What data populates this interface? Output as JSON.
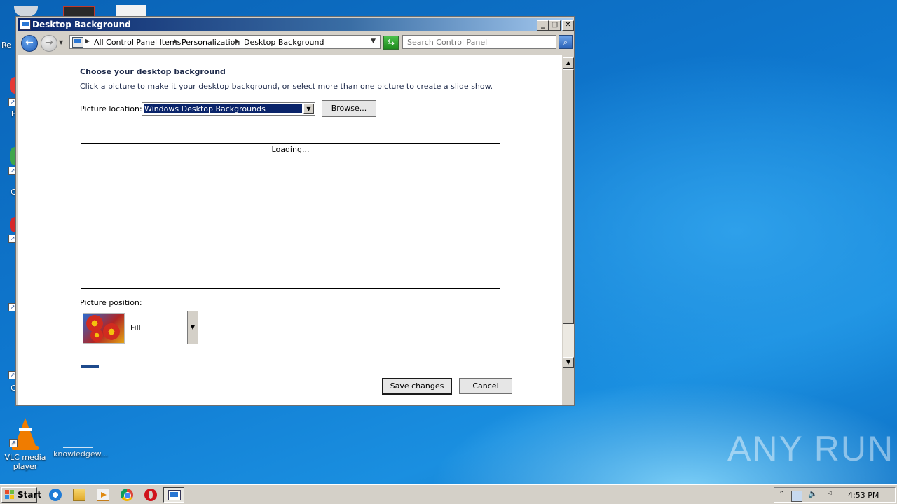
{
  "window": {
    "title": "Desktop Background",
    "minimize_label": "_",
    "maximize_label": "□",
    "close_label": "✕"
  },
  "navigation": {
    "breadcrumbs": [
      "All Control Panel Items",
      "Personalization",
      "Desktop Background"
    ],
    "search_placeholder": "Search Control Panel"
  },
  "page": {
    "heading": "Choose your desktop background",
    "description": "Click a picture to make it your desktop background, or select more than one picture to create a slide show.",
    "picture_location_label": "Picture location:",
    "picture_location_value": "Windows Desktop Backgrounds",
    "browse_button": "Browse...",
    "gallery_status": "Loading...",
    "picture_position_label": "Picture position:",
    "picture_position_value": "Fill",
    "save_button": "Save changes",
    "cancel_button": "Cancel"
  },
  "desktop": {
    "icons": [
      {
        "label": "VLC media player"
      },
      {
        "label": "knowledgew..."
      }
    ],
    "partial_labels": [
      "Re",
      "F",
      "C",
      "C"
    ]
  },
  "watermark": "ANY RUN",
  "taskbar": {
    "start_label": "Start",
    "clock": "4:53 PM",
    "tray_arrow": "⌃"
  }
}
